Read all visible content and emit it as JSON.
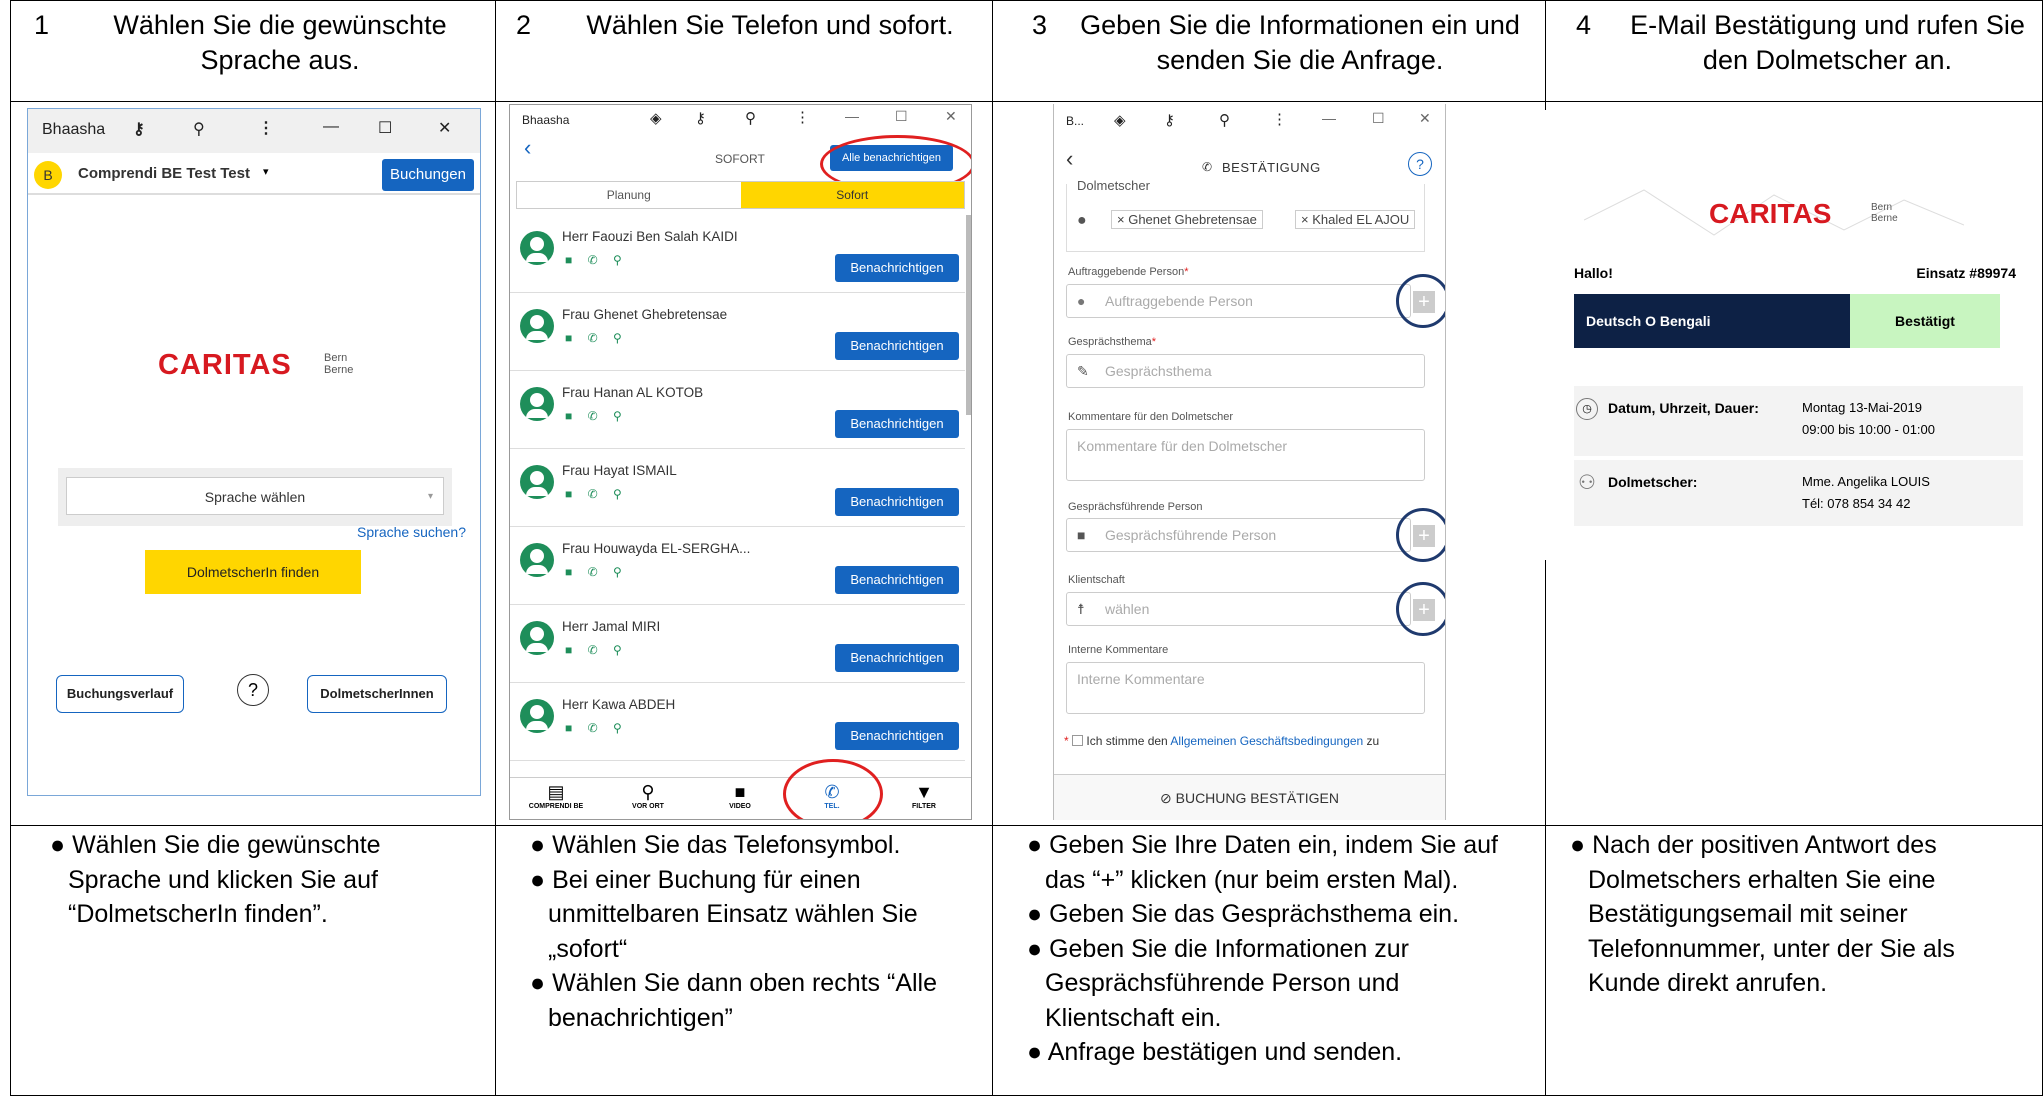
{
  "columns": [
    {
      "num": "1",
      "title": "Wählen Sie die gewünschte Sprache aus.",
      "bullets": [
        "Wählen Sie die gewünschte Sprache und klicken Sie auf “DolmetscherIn finden”."
      ]
    },
    {
      "num": "2",
      "title": "Wählen Sie Telefon und sofort.",
      "bullets": [
        "Wählen Sie das Telefonsymbol.",
        "Bei einer Buchung für einen unmittelbaren Einsatz  wählen Sie „sofort“",
        "Wählen Sie dann oben rechts “Alle benachrichtigen”"
      ]
    },
    {
      "num": "3",
      "title": "Geben Sie die Informationen ein und senden Sie die Anfrage.",
      "bullets": [
        "Geben Sie Ihre Daten ein, indem Sie auf das “+” klicken (nur beim ersten Mal).",
        "Geben Sie das Gesprächsthema ein.",
        "Geben Sie die Informationen zur Gesprächsführende Person und Klientschaft ein.",
        "Anfrage bestätigen und senden."
      ]
    },
    {
      "num": "4",
      "title": "E-Mail Bestätigung und rufen Sie den Dolmetscher an.",
      "bullets": [
        "Nach der positiven Antwort des Dolmetschers erhalten Sie eine Bestätigungsemail mit seiner Telefonnummer, unter der Sie als Kunde direkt anrufen."
      ]
    }
  ],
  "bullet_char": "●",
  "screen1": {
    "app": "Bhaasha",
    "avatar": "B",
    "account": "Comprendi BE Test Test",
    "bookings_btn": "Buchungen",
    "brand": "CARITAS",
    "brand_sub1": "Bern",
    "brand_sub2": "Berne",
    "select": "Sprache wählen",
    "search_link": "Sprache suchen?",
    "find_btn": "DolmetscherIn finden",
    "history_btn": "Buchungsverlauf",
    "help": "?",
    "interpreters_btn": "DolmetscherInnen"
  },
  "screen2": {
    "app": "Bhaasha",
    "header": "SOFORT",
    "notify_all": "Alle benachrichtigen",
    "tab_plan": "Planung",
    "tab_now": "Sofort",
    "notify": "Benachrichtigen",
    "people": [
      "Herr Faouzi Ben Salah KAIDI",
      "Frau Ghenet Ghebretensae",
      "Frau Hanan AL KOTOB",
      "Frau Hayat ISMAIL",
      "Frau Houwayda EL-SERGHA...",
      "Herr Jamal MIRI",
      "Herr Kawa ABDEH"
    ],
    "nav": [
      "COMPRENDI BE",
      "VOR ORT",
      "VIDEO",
      "TEL.",
      "FILTER"
    ]
  },
  "screen3": {
    "app": "B...",
    "header": "BESTÄTIGUNG",
    "help": "?",
    "section": "Dolmetscher",
    "tag1": "× Ghenet Ghebretensae",
    "tag2": "× Khaled EL AJOU",
    "lbl_auftrag": "Auftraggebende Person",
    "ph_auftrag": "Auftraggebende Person",
    "lbl_thema": "Gesprächsthema",
    "ph_thema": "Gesprächsthema",
    "lbl_komm": "Kommentare für den Dolmetscher",
    "ph_komm": "Kommentare für den Dolmetscher",
    "lbl_gfp": "Gesprächsführende Person",
    "ph_gfp": "Gesprächsführende Person",
    "lbl_klient": "Klientschaft",
    "ph_klient": "wählen",
    "lbl_intern": "Interne Kommentare",
    "ph_intern": "Interne Kommentare",
    "required": "*",
    "agb_pre": "Ich stimme den ",
    "agb_link": "Allgemeinen Geschäftsbedingungen",
    "agb_post": " zu",
    "confirm": "BUCHUNG BESTÄTIGEN",
    "plus": "+"
  },
  "screen4": {
    "brand": "CARITAS",
    "brand_sub1": "Bern",
    "brand_sub2": "Berne",
    "hello": "Hallo!",
    "einsatz": "Einsatz #89974",
    "lang": "Deutsch O Bengali",
    "status": "Bestätigt",
    "date_lbl": "Datum, Uhrzeit, Dauer:",
    "date_val1": "Montag 13-Mai-2019",
    "date_val2": "09:00 bis 10:00 - 01:00",
    "dolm_lbl": "Dolmetscher:",
    "dolm_val1": "Mme. Angelika LOUIS",
    "dolm_val2": "Tél: 078 854 34 42"
  },
  "colors": {
    "blue": "#1565c0",
    "yellow": "#ffd600",
    "red": "#e02020",
    "navy": "#0d2145",
    "green_status": "#c8f5c0",
    "caritas_red": "#d71920"
  }
}
